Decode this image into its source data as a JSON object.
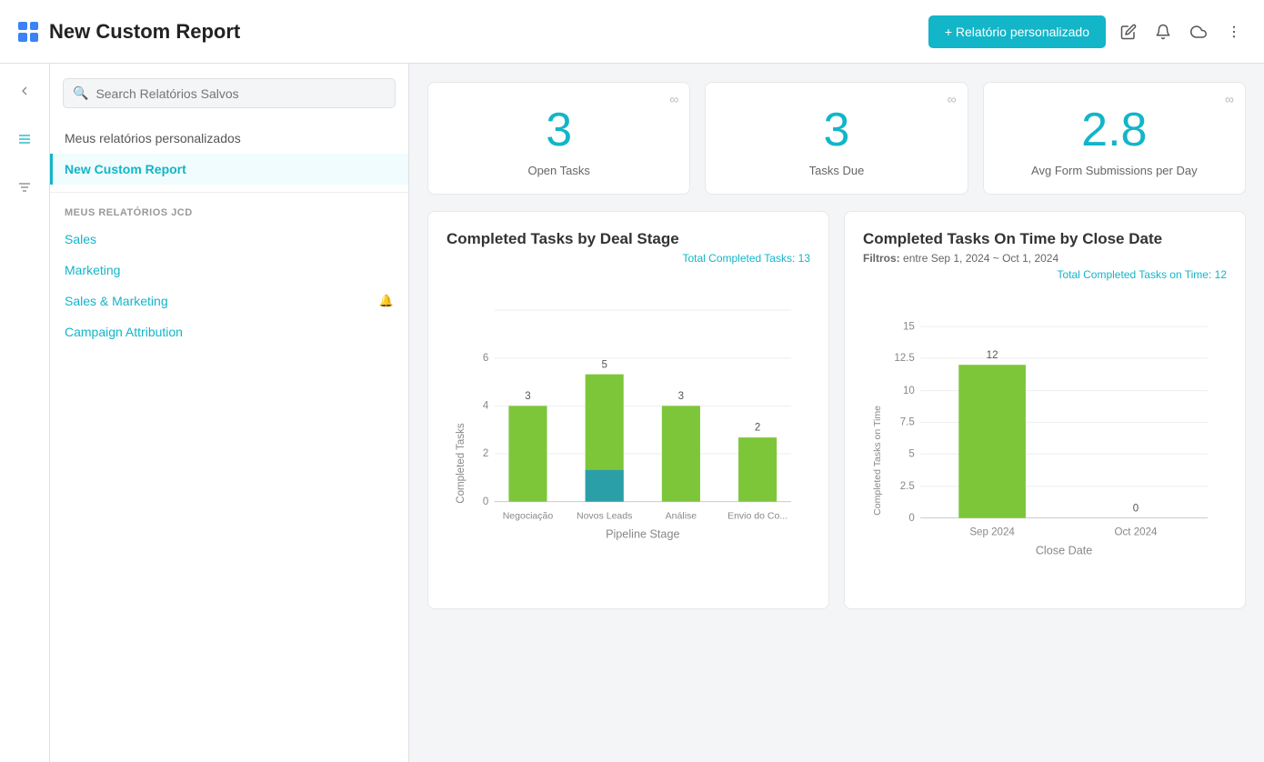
{
  "header": {
    "title": "New Custom Report",
    "btn_label": "+ Relatório personalizado"
  },
  "search": {
    "placeholder": "Search Relatórios Salvos"
  },
  "sidebar_icons": [
    "chevron-left",
    "list",
    "filter"
  ],
  "left_panel": {
    "my_reports_label": "Meus relatórios personalizados",
    "active_item": "New Custom Report",
    "section_label": "MEUS RELATÓRIOS JCD",
    "items": [
      {
        "label": "Sales",
        "has_bell": false
      },
      {
        "label": "Marketing",
        "has_bell": false
      },
      {
        "label": "Sales & Marketing",
        "has_bell": true
      },
      {
        "label": "Campaign Attribution",
        "has_bell": false
      }
    ]
  },
  "metrics": [
    {
      "value": "3",
      "label": "Open Tasks"
    },
    {
      "value": "3",
      "label": "Tasks Due"
    },
    {
      "value": "2.8",
      "label": "Avg Form Submissions per Day"
    }
  ],
  "chart1": {
    "title": "Completed Tasks by Deal Stage",
    "total_label": "Total Completed Tasks: 13",
    "y_axis_label": "Completed Tasks",
    "x_axis_label": "Pipeline Stage",
    "y_ticks": [
      "0",
      "2",
      "4",
      "6"
    ],
    "bars": [
      {
        "label": "Negociação",
        "value": 3,
        "green": 3,
        "teal": 0
      },
      {
        "label": "Novos Leads",
        "value": 5,
        "green": 4,
        "teal": 1
      },
      {
        "label": "Análise",
        "value": 3,
        "green": 3,
        "teal": 0
      },
      {
        "label": "Envio do Co...",
        "value": 2,
        "green": 2,
        "teal": 0
      }
    ]
  },
  "chart2": {
    "title": "Completed Tasks On Time by Close Date",
    "filter_label": "Filtros:",
    "filter_value": "entre Sep 1, 2024 ~ Oct 1, 2024",
    "total_label": "Total Completed Tasks on Time: 12",
    "y_axis_label": "Completed Tasks on Time",
    "x_axis_label": "Close Date",
    "y_ticks": [
      "0",
      "2.5",
      "5",
      "7.5",
      "10",
      "12.5",
      "15"
    ],
    "bars": [
      {
        "label": "Sep 2024",
        "value": 12
      },
      {
        "label": "Oct 2024",
        "value": 0
      }
    ]
  },
  "colors": {
    "green": "#7dc63a",
    "teal": "#2a9fa8",
    "accent": "#13b5c8"
  }
}
